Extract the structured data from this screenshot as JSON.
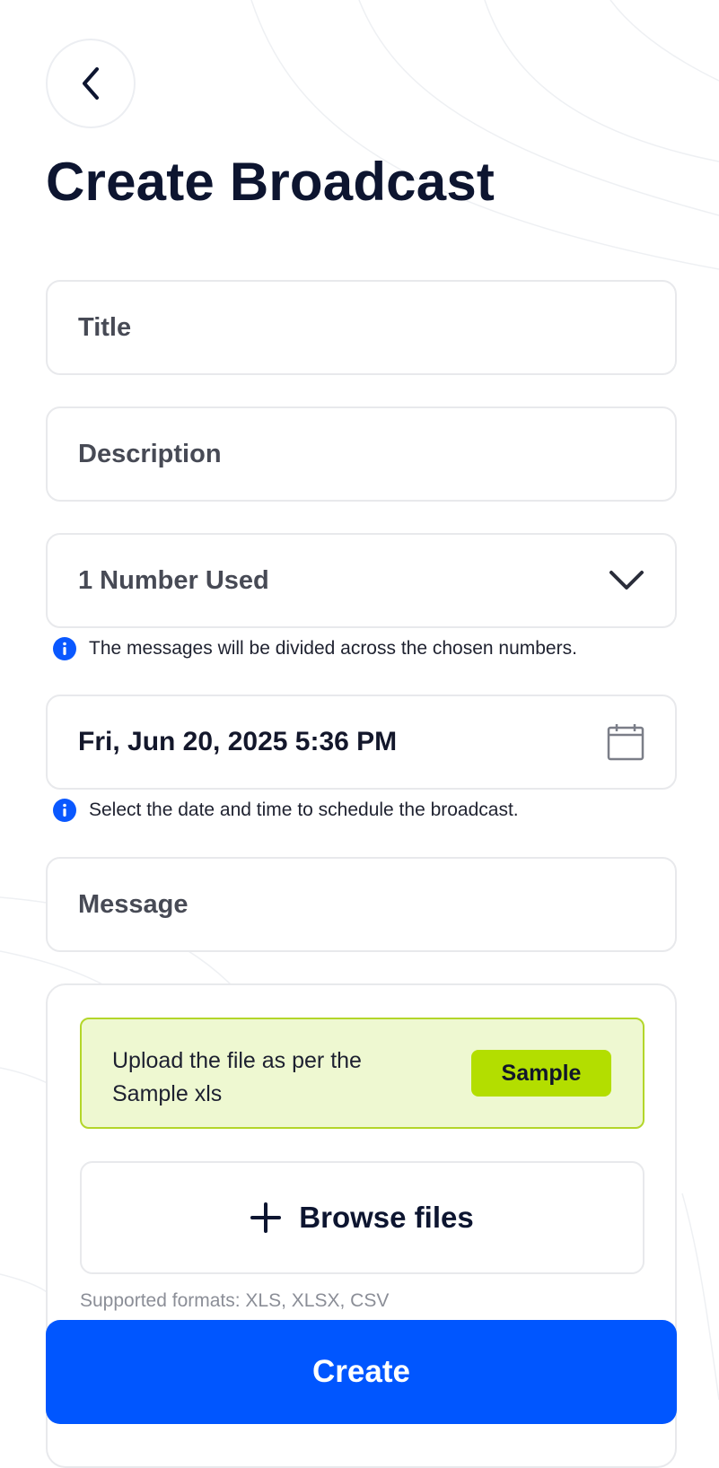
{
  "header": {
    "back_icon": "chevron-left-icon",
    "title": "Create Broadcast"
  },
  "form": {
    "title_placeholder": "Title",
    "description_placeholder": "Description",
    "numbers": {
      "value": "1 Number Used",
      "icon": "chevron-down-icon",
      "hint": "The messages will be divided across the chosen numbers."
    },
    "schedule": {
      "value": "Fri, Jun 20, 2025 5:36 PM",
      "icon": "calendar-icon",
      "hint": "Select the date and time to schedule the broadcast."
    },
    "message_placeholder": "Message",
    "upload": {
      "instruction": "Upload the file as per the Sample xls",
      "sample_label": "Sample",
      "browse_label": "Browse files",
      "browse_icon": "plus-icon",
      "formats": "Supported formats: XLS, XLSX, CSV"
    }
  },
  "actions": {
    "create_label": "Create"
  },
  "colors": {
    "primary": "#0056ff",
    "accent_lime": "#b3de00",
    "info_blue": "#0a58ff",
    "title_text": "#0d1530"
  }
}
